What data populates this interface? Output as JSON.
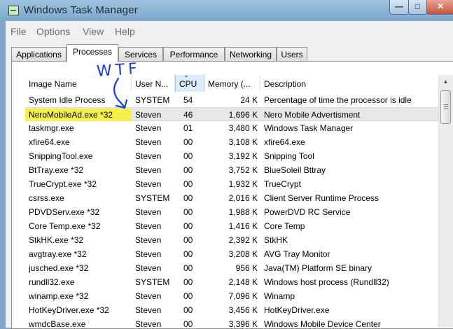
{
  "window": {
    "title": "Windows Task Manager",
    "minimize_icon": "minimize-icon",
    "maximize_icon": "maximize-icon",
    "close_icon": "close-icon",
    "app_icon": "task-manager-icon"
  },
  "menu": [
    "File",
    "Options",
    "View",
    "Help"
  ],
  "tabs": [
    "Applications",
    "Processes",
    "Services",
    "Performance",
    "Networking",
    "Users"
  ],
  "active_tab": "Processes",
  "columns": [
    "Image Name",
    "User N...",
    "CPU",
    "Memory (...",
    "Description"
  ],
  "sorted_column": "CPU",
  "annotation": "WTF",
  "annotation_color": "#1b3fd0",
  "highlight_color": "#f7f04a",
  "rows": [
    {
      "name": "System Idle Process",
      "user": "SYSTEM",
      "cpu": "54",
      "memory": "24 K",
      "description": "Percentage of time the processor is idle"
    },
    {
      "name": "NeroMobileAd.exe *32",
      "user": "Steven",
      "cpu": "46",
      "memory": "1,696 K",
      "description": "Nero Mobile Advertisment",
      "selected": true,
      "highlighted": true
    },
    {
      "name": "taskmgr.exe",
      "user": "Steven",
      "cpu": "01",
      "memory": "3,480 K",
      "description": "Windows Task Manager"
    },
    {
      "name": "xfire64.exe",
      "user": "Steven",
      "cpu": "00",
      "memory": "3,108 K",
      "description": "xfire64.exe"
    },
    {
      "name": "SnippingTool.exe",
      "user": "Steven",
      "cpu": "00",
      "memory": "3,192 K",
      "description": "Snipping Tool"
    },
    {
      "name": "BtTray.exe *32",
      "user": "Steven",
      "cpu": "00",
      "memory": "3,752 K",
      "description": "BlueSoleil Bttray"
    },
    {
      "name": "TrueCrypt.exe *32",
      "user": "Steven",
      "cpu": "00",
      "memory": "1,932 K",
      "description": "TrueCrypt"
    },
    {
      "name": "csrss.exe",
      "user": "SYSTEM",
      "cpu": "00",
      "memory": "2,016 K",
      "description": "Client Server Runtime Process"
    },
    {
      "name": "PDVDServ.exe *32",
      "user": "Steven",
      "cpu": "00",
      "memory": "1,988 K",
      "description": "PowerDVD RC Service"
    },
    {
      "name": "Core Temp.exe *32",
      "user": "Steven",
      "cpu": "00",
      "memory": "1,416 K",
      "description": "Core Temp"
    },
    {
      "name": "StkHK.exe *32",
      "user": "Steven",
      "cpu": "00",
      "memory": "2,392 K",
      "description": "StkHK"
    },
    {
      "name": "avgtray.exe *32",
      "user": "Steven",
      "cpu": "00",
      "memory": "3,208 K",
      "description": "AVG Tray Monitor"
    },
    {
      "name": "jusched.exe *32",
      "user": "Steven",
      "cpu": "00",
      "memory": "956 K",
      "description": "Java(TM) Platform SE binary"
    },
    {
      "name": "rundll32.exe",
      "user": "SYSTEM",
      "cpu": "00",
      "memory": "2,148 K",
      "description": "Windows host process (Rundll32)"
    },
    {
      "name": "winamp.exe *32",
      "user": "Steven",
      "cpu": "00",
      "memory": "7,096 K",
      "description": "Winamp"
    },
    {
      "name": "HotKeyDriver.exe *32",
      "user": "Steven",
      "cpu": "00",
      "memory": "3,456 K",
      "description": "HotKeyDriver.exe"
    },
    {
      "name": "wmdcBase.exe",
      "user": "Steven",
      "cpu": "00",
      "memory": "3,396 K",
      "description": "Windows Mobile Device Center"
    }
  ]
}
